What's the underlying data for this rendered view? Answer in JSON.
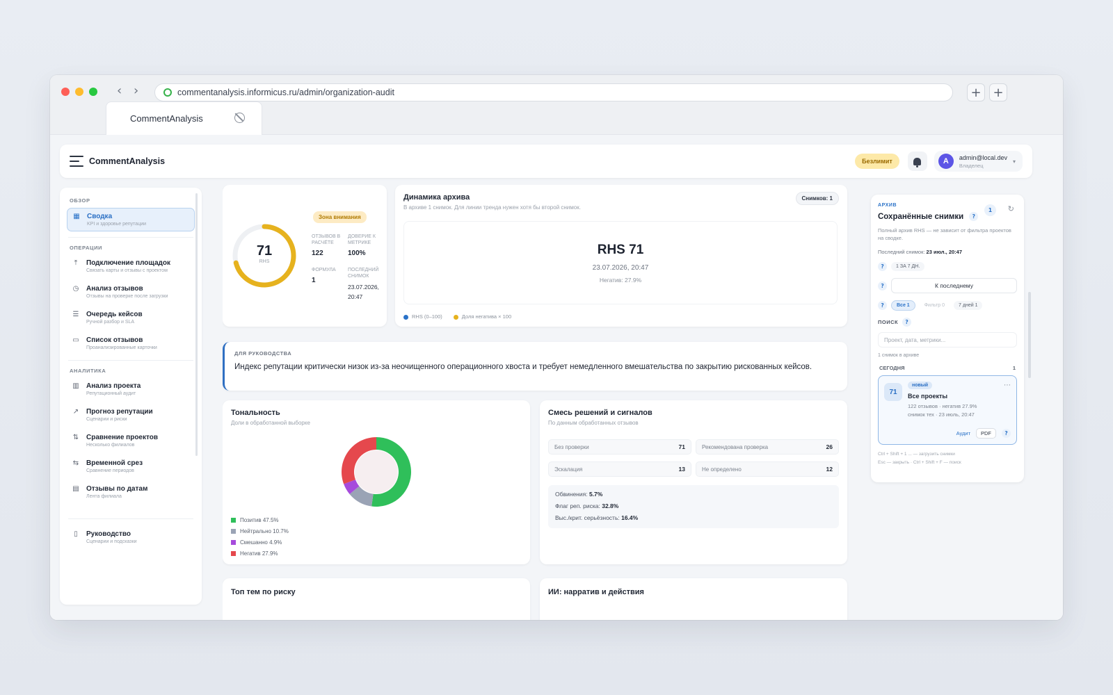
{
  "browser": {
    "url": "commentanalysis.informicus.ru/admin/organization-audit",
    "tab_title": "CommentAnalysis"
  },
  "header": {
    "brand": "CommentAnalysis",
    "plan_badge": "Безлимит",
    "user_initial": "A",
    "user_email": "admin@local.dev",
    "user_role": "Владелец"
  },
  "sidebar": {
    "sections": [
      {
        "title": "ОБЗОР",
        "items": [
          {
            "label": "Сводка",
            "sub": "KPI и здоровье репутации",
            "icon": "▦",
            "active": true
          }
        ]
      },
      {
        "title": "ОПЕРАЦИИ",
        "items": [
          {
            "label": "Подключение площадок",
            "sub": "Связать карты и отзывы с проектом",
            "icon": "⤒"
          },
          {
            "label": "Анализ отзывов",
            "sub": "Отзывы на проверке после загрузки",
            "icon": "◷"
          },
          {
            "label": "Очередь кейсов",
            "sub": "Ручной разбор и SLA",
            "icon": "☰"
          },
          {
            "label": "Список отзывов",
            "sub": "Проанализированные карточки",
            "icon": "▭"
          }
        ]
      },
      {
        "title": "АНАЛИТИКА",
        "items": [
          {
            "label": "Анализ проекта",
            "sub": "Репутационный аудит",
            "icon": "▥"
          },
          {
            "label": "Прогноз репутации",
            "sub": "Сценарии и риски",
            "icon": "↗"
          },
          {
            "label": "Сравнение проектов",
            "sub": "Несколько филиалов",
            "icon": "⇅"
          },
          {
            "label": "Временной срез",
            "sub": "Сравнение периодов",
            "icon": "⇆"
          },
          {
            "label": "Отзывы по датам",
            "sub": "Лента филиала",
            "icon": "▤"
          }
        ]
      }
    ],
    "footer_item": {
      "label": "Руководство",
      "sub": "Сценарии и подсказки",
      "icon": "▯"
    }
  },
  "kpi": {
    "score": "71",
    "score_label": "RHS",
    "score_fraction": 0.71,
    "badge": "Зона внимания",
    "reviews_label": "ОТЗЫВОВ В РАСЧЁТЕ",
    "reviews_value": "122",
    "trust_label": "ДОВЕРИЕ К МЕТРИКЕ",
    "trust_value": "100%",
    "formula_label": "ФОРМУЛА",
    "formula_value": "1",
    "last_label": "ПОСЛЕДНИЙ СНИМОК",
    "last_value": "23.07.2026, 20:47",
    "ring_color": "#e6b21e"
  },
  "archive": {
    "title": "Динамика архива",
    "subtitle": "В архиве 1 снимок. Для линии тренда нужен хотя бы второй снимок.",
    "badge": "Снимков: 1",
    "rhs": "RHS 71",
    "date": "23.07.2026, 20:47",
    "negative": "Негатив: 27.9%",
    "legend1": "RHS (0–100)",
    "legend2": "Доля негатива × 100",
    "legend1_color": "#2a72c8",
    "legend2_color": "#e6b21e"
  },
  "management": {
    "kicker": "ДЛЯ РУКОВОДСТВА",
    "text": "Индекс репутации критически низок из-за неочищенного операционного хвоста и требует немедленного вмешательства по закрытию рискованных кейсов."
  },
  "sentiment": {
    "title": "Тональность",
    "subtitle": "Доли в обработанной выборке",
    "legend": [
      "Позитив 47.5%",
      "Нейтрально 10.7%",
      "Смешанно 4.9%",
      "Негатив 27.9%"
    ]
  },
  "chart_data": {
    "type": "pie",
    "categories": [
      "Позитив",
      "Нейтрально",
      "Смешанно",
      "Негатив"
    ],
    "values": [
      47.5,
      10.7,
      4.9,
      27.9
    ],
    "colors": [
      "#2fbf5a",
      "#9aa3b5",
      "#a64bdc",
      "#e5484d"
    ],
    "donut": true
  },
  "decisions": {
    "title": "Смесь решений и сигналов",
    "subtitle": "По данным обработанных отзывов",
    "cells": [
      {
        "label": "Без проверки",
        "value": "71"
      },
      {
        "label": "Рекомендована проверка",
        "value": "26"
      },
      {
        "label": "Эскалация",
        "value": "13"
      },
      {
        "label": "Не определено",
        "value": "12"
      }
    ],
    "sig1_label": "Обвинения:",
    "sig1_value": "5.7%",
    "sig2_label": "Флаг реп. риска:",
    "sig2_value": "32.8%",
    "sig3_label": "Выс./крит. серьёзность:",
    "sig3_value": "16.4%"
  },
  "bottom": {
    "left_title": "Топ тем по риску",
    "right_title": "ИИ: нарратив и действия"
  },
  "saved": {
    "kicker": "АРХИВ",
    "title": "Сохранённые снимки",
    "desc": "Полный архив RHS — не зависит от фильтра проектов на сводке.",
    "last_label": "Последний снимок:",
    "last_value": "23 июл., 20:47",
    "counter": "1",
    "chip_period": "1 ЗА 7 ДН.",
    "btn_latest": "К последнему",
    "chip_all": "Все 1",
    "chip_filter": "Фильтр 0",
    "chip_7d": "7 дней 1",
    "search_label": "ПОИСК",
    "search_placeholder": "Проект, дата, метрики...",
    "count_text": "1 снимок в архиве",
    "today_label": "СЕГОДНЯ",
    "today_count": "1",
    "card_score": "71",
    "card_badge": "новый",
    "card_name": "Все проекты",
    "card_meta1": "122 отзывов · негатив 27.9%",
    "card_meta2": "снимок тех · 23 июль, 20:47",
    "card_audit": "Аудит",
    "card_pdf": "PDF",
    "hint1": "Ctrl + Shift + 1 ... — загрузить снимки",
    "hint2": "Esc — закрыть · Ctrl + Shift + F — поиск"
  }
}
